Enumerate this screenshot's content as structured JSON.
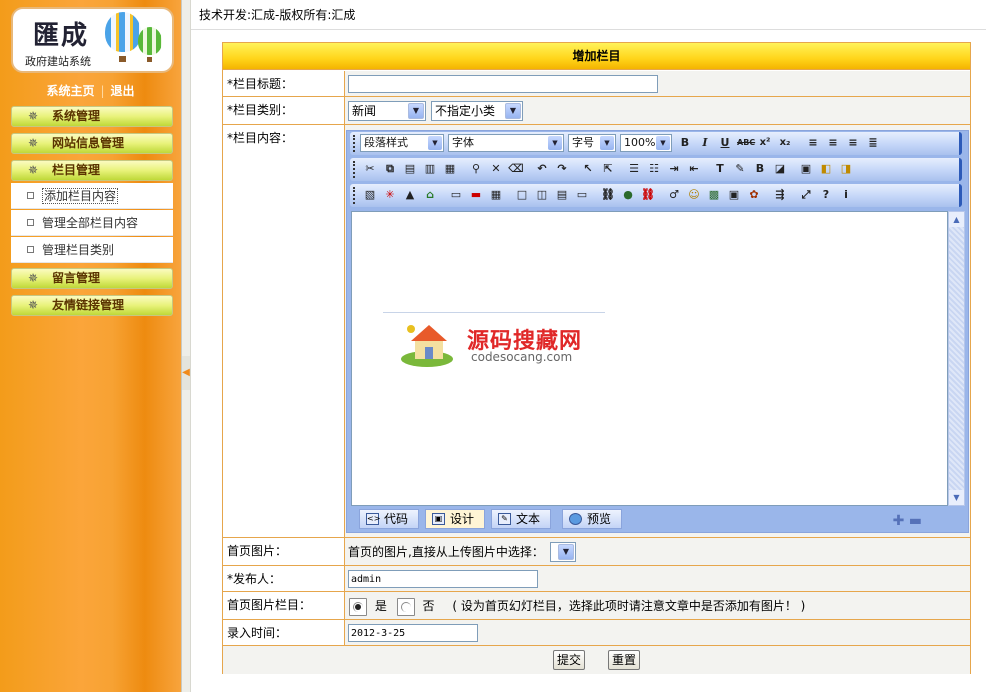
{
  "header": {
    "copyright": "技术开发:汇成-版权所有:汇成"
  },
  "logo": {
    "title": "匯成",
    "subtitle": "政府建站系统"
  },
  "topnav": {
    "home": "系统主页",
    "separator": "|",
    "logout": "退出"
  },
  "menu": {
    "system": "系统管理",
    "site_info": "网站信息管理",
    "column": "栏目管理",
    "column_items": [
      "添加栏目内容",
      "管理全部栏目内容",
      "管理栏目类别"
    ],
    "guestbook": "留言管理",
    "links": "友情链接管理"
  },
  "form": {
    "title": "增加栏目",
    "title_label": "*栏目标题：",
    "title_value": "",
    "category_label": "*栏目类别：",
    "category_value": "新闻",
    "subcategory_value": "不指定小类",
    "content_label": "*栏目内容：",
    "image_label": "首页图片：",
    "image_hint": "首页的图片,直接从上传图片中选择：",
    "publisher_label": "*发布人：",
    "publisher_value": "admin",
    "slide_label": "首页图片栏目：",
    "slide_yes": "是",
    "slide_no": "否",
    "slide_hint": "( 设为首页幻灯栏目，选择此项时请注意文章中是否添加有图片！ )",
    "time_label": "录入时间：",
    "time_value": "2012-3-25",
    "submit": "提交",
    "reset": "重置"
  },
  "editor": {
    "paragraph_style": "段落样式",
    "font": "字体",
    "font_size": "字号",
    "zoom": "100%",
    "tabs": [
      "代码",
      "设计",
      "文本",
      "预览"
    ],
    "active_tab": "设计"
  },
  "watermark": {
    "cn": "源码搜藏网",
    "en": "codesocang.com"
  },
  "colors": {
    "accent": "#f39c1a",
    "title_bar": "#ffd51a",
    "border": "#e6a64c",
    "editor_blue": "#9ab6ea"
  }
}
